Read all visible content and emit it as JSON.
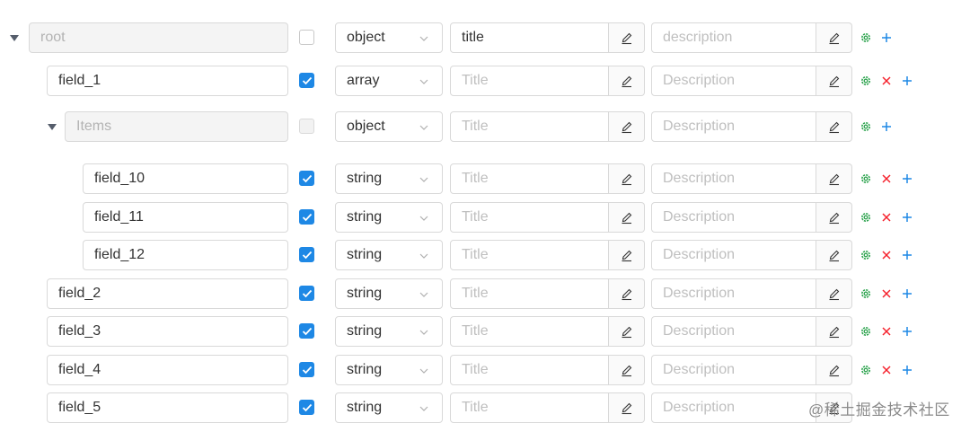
{
  "rows": [
    {
      "key": "root",
      "name": "root",
      "name_disabled": true,
      "caret": true,
      "checked": false,
      "check_disabled": false,
      "type": "object",
      "title": "title",
      "title_placeholder": false,
      "description": "description",
      "remove": false
    },
    {
      "key": "field_1",
      "name": "field_1",
      "name_disabled": false,
      "caret": false,
      "checked": true,
      "check_disabled": false,
      "type": "array",
      "title": "Title",
      "title_placeholder": true,
      "description": "Description",
      "remove": true
    },
    {
      "key": "items",
      "name": "Items",
      "name_disabled": true,
      "caret": true,
      "checked": false,
      "check_disabled": true,
      "type": "object",
      "title": "Title",
      "title_placeholder": true,
      "description": "Description",
      "remove": false
    },
    {
      "key": "field_10",
      "name": "field_10",
      "name_disabled": false,
      "caret": false,
      "checked": true,
      "check_disabled": false,
      "type": "string",
      "title": "Title",
      "title_placeholder": true,
      "description": "Description",
      "remove": true
    },
    {
      "key": "field_11",
      "name": "field_11",
      "name_disabled": false,
      "caret": false,
      "checked": true,
      "check_disabled": false,
      "type": "string",
      "title": "Title",
      "title_placeholder": true,
      "description": "Description",
      "remove": true
    },
    {
      "key": "field_12",
      "name": "field_12",
      "name_disabled": false,
      "caret": false,
      "checked": true,
      "check_disabled": false,
      "type": "string",
      "title": "Title",
      "title_placeholder": true,
      "description": "Description",
      "remove": true
    },
    {
      "key": "field_2",
      "name": "field_2",
      "name_disabled": false,
      "caret": false,
      "checked": true,
      "check_disabled": false,
      "type": "string",
      "title": "Title",
      "title_placeholder": true,
      "description": "Description",
      "remove": true
    },
    {
      "key": "field_3",
      "name": "field_3",
      "name_disabled": false,
      "caret": false,
      "checked": true,
      "check_disabled": false,
      "type": "string",
      "title": "Title",
      "title_placeholder": true,
      "description": "Description",
      "remove": true
    },
    {
      "key": "field_4",
      "name": "field_4",
      "name_disabled": false,
      "caret": false,
      "checked": true,
      "check_disabled": false,
      "type": "string",
      "title": "Title",
      "title_placeholder": true,
      "description": "Description",
      "remove": true
    },
    {
      "key": "field_5",
      "name": "field_5",
      "name_disabled": false,
      "caret": false,
      "checked": true,
      "check_disabled": false,
      "type": "string",
      "title": "Title",
      "title_placeholder": true,
      "description": "Description",
      "remove": true
    }
  ],
  "watermark": "@稀土掘金技术社区",
  "colors": {
    "checkbox_blue": "#1e88e5",
    "settings_green": "#2ea44f",
    "remove_red": "#f5222d",
    "add_blue": "#1e88e5",
    "placeholder_gray": "#bfbfbf",
    "border_gray": "#d9d9d9"
  },
  "icons": {
    "expand": "caret-down-icon",
    "type_select": "chevron-down-icon",
    "edit": "pencil-icon",
    "settings": "gear-icon",
    "remove": "close-icon",
    "add": "plus-icon"
  }
}
